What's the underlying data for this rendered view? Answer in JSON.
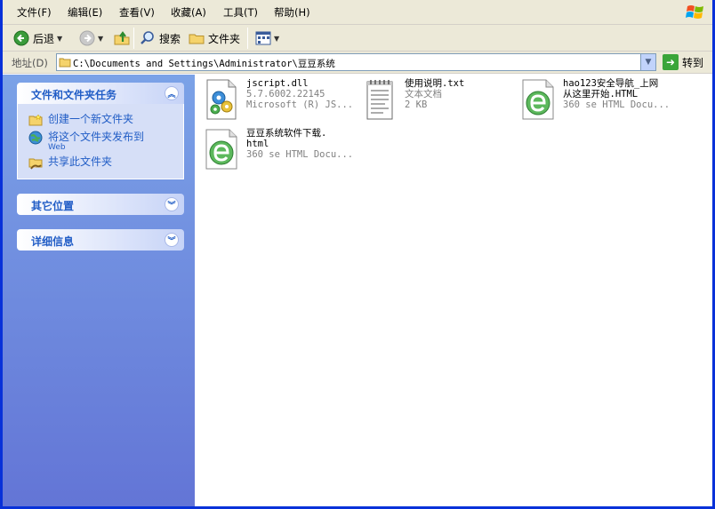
{
  "menu": {
    "file": "文件(F)",
    "edit": "编辑(E)",
    "view": "查看(V)",
    "favorites": "收藏(A)",
    "tools": "工具(T)",
    "help": "帮助(H)"
  },
  "toolbar": {
    "back": "后退",
    "search": "搜索",
    "folders": "文件夹"
  },
  "address": {
    "label": "地址(D)",
    "path": "C:\\Documents and Settings\\Administrator\\豆豆系统",
    "go": "转到"
  },
  "sidebar": {
    "tasks_title": "文件和文件夹任务",
    "tasks": [
      {
        "label": "创建一个新文件夹",
        "icon": "new-folder-icon"
      },
      {
        "label": "将这个文件夹发布到",
        "sub": "Web",
        "icon": "publish-web-icon"
      },
      {
        "label": "共享此文件夹",
        "icon": "share-folder-icon"
      }
    ],
    "other_places_title": "其它位置",
    "details_title": "详细信息"
  },
  "files": [
    {
      "name": "jscript.dll",
      "line2": "5.7.6002.22145",
      "line3": "Microsoft (R) JS...",
      "icon": "dll-icon"
    },
    {
      "name": "使用说明.txt",
      "line2": "文本文档",
      "line3": "2 KB",
      "icon": "text-document-icon"
    },
    {
      "name": "hao123安全导航_上网",
      "line2": "从这里开始.HTML",
      "line3": "360 se HTML Docu...",
      "icon": "360se-html-icon"
    },
    {
      "name": "豆豆系统软件下载.",
      "line2": "html",
      "line3": "360 se HTML Docu...",
      "icon": "360se-html-icon"
    }
  ],
  "colors": {
    "sidebar_link": "#215dc6",
    "title_blue": "#0831d9",
    "chrome": "#ece9d8"
  }
}
